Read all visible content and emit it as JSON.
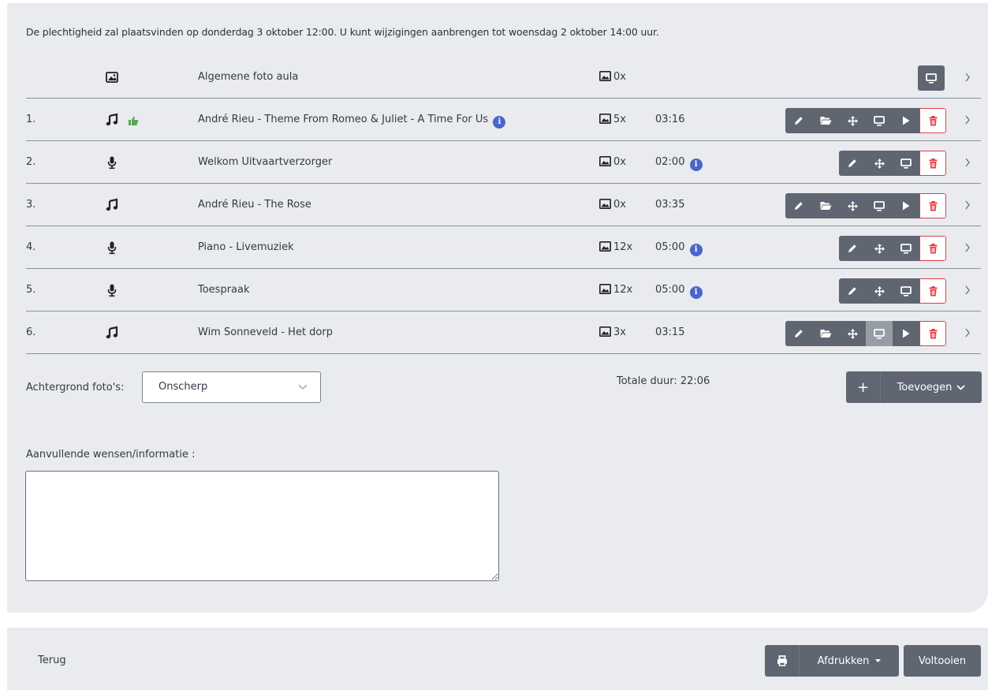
{
  "notice": "De plechtigheid zal plaatsvinden op donderdag 3 oktober 12:00. U kunt wijzigingen aanbrengen tot woensdag 2 oktober 14:00 uur.",
  "header_row": {
    "title": "Algemene foto aula",
    "photos": "0x",
    "type_icon": "image-icon"
  },
  "rows": [
    {
      "num": "1.",
      "title": "André Rieu - Theme From Romeo & Juliet - A Time For Us",
      "photos": "5x",
      "duration": "03:16",
      "type_icon": "music-icon",
      "liked": true,
      "title_info": true,
      "duration_info": false
    },
    {
      "num": "2.",
      "title": "Welkom Uitvaartverzorger",
      "photos": "0x",
      "duration": "02:00",
      "type_icon": "microphone-icon",
      "liked": false,
      "title_info": false,
      "duration_info": true
    },
    {
      "num": "3.",
      "title": "André Rieu - The Rose",
      "photos": "0x",
      "duration": "03:35",
      "type_icon": "music-icon",
      "liked": false,
      "title_info": false,
      "duration_info": false
    },
    {
      "num": "4.",
      "title": "Piano - Livemuziek",
      "photos": "12x",
      "duration": "05:00",
      "type_icon": "microphone-icon",
      "liked": false,
      "title_info": false,
      "duration_info": true
    },
    {
      "num": "5.",
      "title": "Toespraak",
      "photos": "12x",
      "duration": "05:00",
      "type_icon": "microphone-icon",
      "liked": false,
      "title_info": false,
      "duration_info": true
    },
    {
      "num": "6.",
      "title": "Wim Sonneveld - Het dorp",
      "photos": "3x",
      "duration": "03:15",
      "type_icon": "music-icon",
      "liked": false,
      "title_info": false,
      "duration_info": false
    }
  ],
  "background": {
    "label": "Achtergrond foto's:",
    "selected": "Onscherp"
  },
  "total": "Totale duur: 22:06",
  "add": {
    "plus": "+",
    "label": "Toevoegen"
  },
  "wishes": {
    "label": "Aanvullende wensen/informatie :",
    "value": ""
  },
  "footer": {
    "back": "Terug",
    "print": "Afdrukken",
    "finish": "Voltooien"
  },
  "colors": {
    "button": "#5f6671",
    "button_active": "#979da6",
    "delete": "#e23b45",
    "info": "#4a66c8",
    "like": "#5aa55a",
    "panel": "#e9ebee"
  }
}
